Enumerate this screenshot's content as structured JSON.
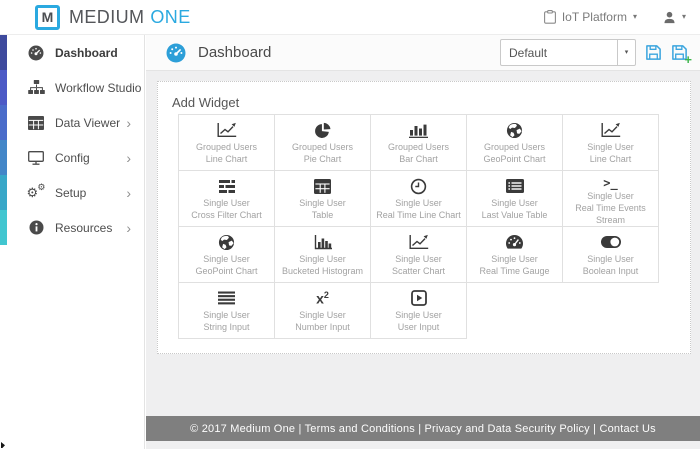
{
  "header": {
    "logo_letter": "M",
    "brand_part1": "MEDIUM",
    "brand_part2": "ONE",
    "platform_menu": "IoT Platform"
  },
  "sidebar": {
    "chevron_char": "›",
    "accent_colors": [
      "#3e4a9d",
      "#4c5ac6",
      "#4a6cca",
      "#4386c8",
      "#38a7c8",
      "#41c6d0"
    ],
    "items": [
      {
        "label": "Dashboard",
        "icon": "tachometer-icon",
        "chevron": false,
        "active": true
      },
      {
        "label": "Workflow Studio",
        "icon": "sitemap-icon",
        "chevron": false,
        "active": false
      },
      {
        "label": "Data Viewer",
        "icon": "table-icon",
        "chevron": true,
        "active": false
      },
      {
        "label": "Config",
        "icon": "desktop-icon",
        "chevron": true,
        "active": false
      },
      {
        "label": "Setup",
        "icon": "gears-icon",
        "chevron": true,
        "active": false
      },
      {
        "label": "Resources",
        "icon": "info-icon",
        "chevron": true,
        "active": false
      }
    ]
  },
  "content": {
    "title": "Dashboard",
    "select_value": "Default",
    "panel_title": "Add Widget",
    "widgets": [
      {
        "icon": "line-chart-icon",
        "line1": "Grouped Users",
        "line2": "Line Chart"
      },
      {
        "icon": "pie-chart-icon",
        "line1": "Grouped Users",
        "line2": "Pie Chart"
      },
      {
        "icon": "bar-chart-icon",
        "line1": "Grouped Users",
        "line2": "Bar Chart"
      },
      {
        "icon": "globe-icon",
        "line1": "Grouped Users",
        "line2": "GeoPoint Chart"
      },
      {
        "icon": "line-chart-icon",
        "line1": "Single User",
        "line2": "Line Chart"
      },
      {
        "icon": "cross-filter-icon",
        "line1": "Single User",
        "line2": "Cross Filter Chart"
      },
      {
        "icon": "table-widget-icon",
        "line1": "Single User",
        "line2": "Table"
      },
      {
        "icon": "clock-icon",
        "line1": "Single User",
        "line2": "Real Time Line Chart"
      },
      {
        "icon": "list-alt-icon",
        "line1": "Single User",
        "line2": "Last Value Table"
      },
      {
        "icon": "terminal-icon",
        "line1": "Single User",
        "line2": "Real Time Events Stream"
      },
      {
        "icon": "globe-icon",
        "line1": "Single User",
        "line2": "GeoPoint Chart"
      },
      {
        "icon": "histogram-icon",
        "line1": "Single User",
        "line2": "Bucketed Histogram"
      },
      {
        "icon": "scatter-chart-icon",
        "line1": "Single User",
        "line2": "Scatter Chart"
      },
      {
        "icon": "gauge-icon",
        "line1": "Single User",
        "line2": "Real Time Gauge"
      },
      {
        "icon": "toggle-icon",
        "line1": "Single User",
        "line2": "Boolean Input"
      },
      {
        "icon": "string-input-icon",
        "line1": "Single User",
        "line2": "String Input"
      },
      {
        "icon": "number-input-icon",
        "line1": "Single User",
        "line2": "Number Input"
      },
      {
        "icon": "play-square-icon",
        "line1": "Single User",
        "line2": "User Input"
      }
    ]
  },
  "footer": {
    "text": "© 2017 Medium One | Terms and Conditions | Privacy and Data Security Policy | Contact Us"
  },
  "colors": {
    "brand_blue": "#2aa9e0",
    "accent_green": "#3cb54b",
    "footer_bg": "#7f7f7f",
    "body_bg": "#efeff0"
  }
}
